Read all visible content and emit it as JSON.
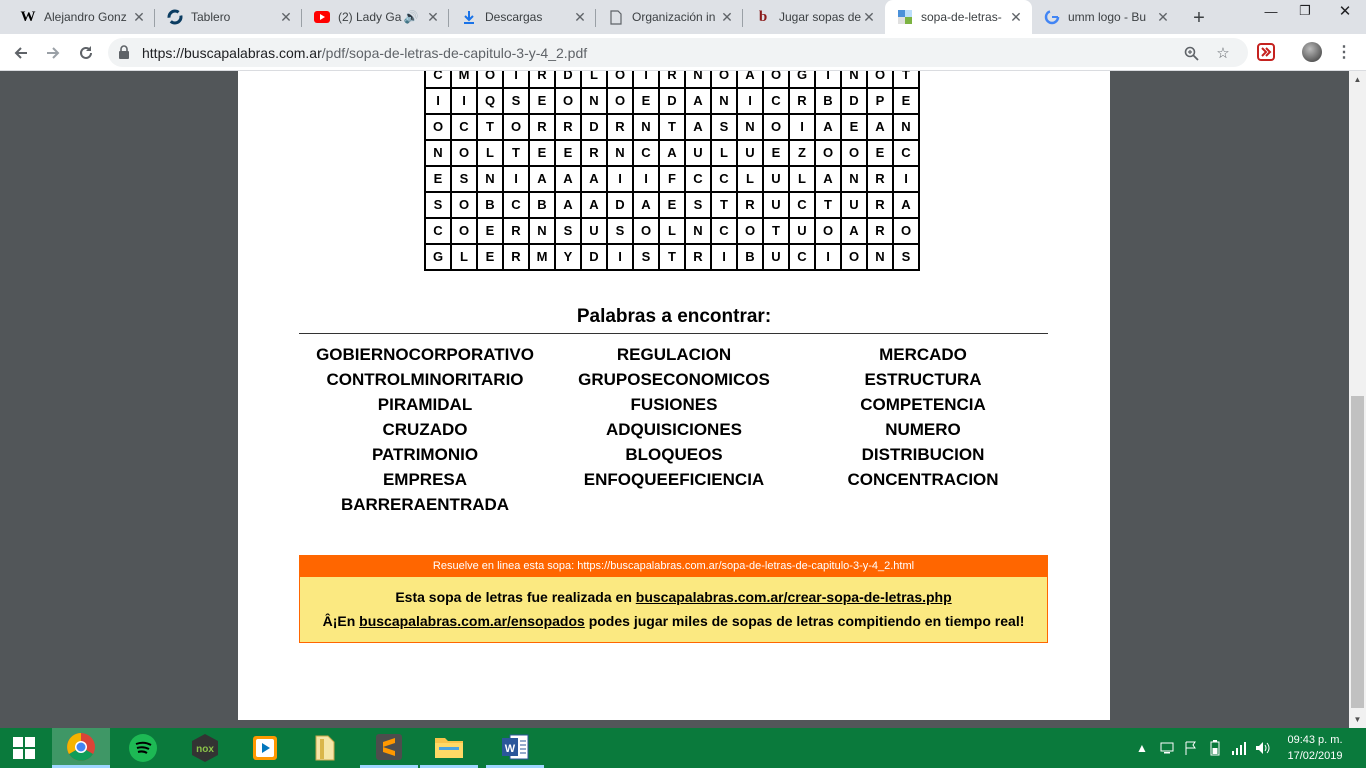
{
  "browser": {
    "tabs": [
      {
        "title": "Alejandro Gonz",
        "icon": "wikipedia-icon"
      },
      {
        "title": "Tablero",
        "icon": "tablero-icon"
      },
      {
        "title": "(2) Lady Ga",
        "icon": "youtube-icon"
      },
      {
        "title": "Descargas",
        "icon": "download-icon"
      },
      {
        "title": "Organización in",
        "icon": "document-icon"
      },
      {
        "title": "Jugar sopas de",
        "icon": "b-logo-icon"
      },
      {
        "title": "sopa-de-letras-",
        "icon": "pdf-site-icon",
        "active": true
      },
      {
        "title": "umm logo - Bu",
        "icon": "google-icon"
      }
    ],
    "url_host": "https://buscapalabras.com.ar",
    "url_path": "/pdf/sopa-de-letras-de-capitulo-3-y-4_2.pdf"
  },
  "puzzle": {
    "rows": [
      "CMOIRDLOIRNOAOGINOT",
      "IIQSEONOEDANICRBDPE",
      "OCTORRDRNTASNOIAEAN",
      "NOLTEERNCAULUEZOOEC",
      "ESNIAAAIIFCCLULANRI",
      "SOBCBAADAESTRUCTURA",
      "COERNSUSOLNCOTUOARO",
      "GLERMYDISTRIBUCIONS"
    ],
    "heading": "Palabras a encontrar:",
    "words": {
      "col1": [
        "GOBIERNOCORPORATIVO",
        "CONTROLMINORITARIO",
        "PIRAMIDAL",
        "CRUZADO",
        "PATRIMONIO",
        "EMPRESA",
        "BARRERAENTRADA"
      ],
      "col2": [
        "REGULACION",
        "GRUPOSECONOMICOS",
        "FUSIONES",
        "ADQUISICIONES",
        "BLOQUEOS",
        "ENFOQUEEFICIENCIA"
      ],
      "col3": [
        "MERCADO",
        "ESTRUCTURA",
        "COMPETENCIA",
        "NUMERO",
        "DISTRIBUCION",
        "CONCENTRACION"
      ]
    }
  },
  "banner": {
    "top": "Resuelve en linea esta sopa: https://buscapalabras.com.ar/sopa-de-letras-de-capitulo-3-y-4_2.html",
    "line1_pre": "Esta sopa de letras fue realizada en ",
    "line1_link": "buscapalabras.com.ar/crear-sopa-de-letras.php",
    "line2_pre": "Â¡En ",
    "line2_link": "buscapalabras.com.ar/ensopados",
    "line2_post": " podes jugar miles de sopas de letras compitiendo en tiempo real!"
  },
  "taskbar": {
    "apps": [
      "chrome-icon",
      "spotify-icon",
      "nox-icon",
      "video-player-icon",
      "file-icon",
      "file-explorer-icon",
      "sublime-text-icon",
      "word-icon"
    ],
    "time": "09:43 p. m.",
    "date": "17/02/2019"
  },
  "colors": {
    "banner_orange": "#ff6600",
    "banner_yellow": "#fbe981",
    "taskbar_green": "#0a7a3c"
  }
}
